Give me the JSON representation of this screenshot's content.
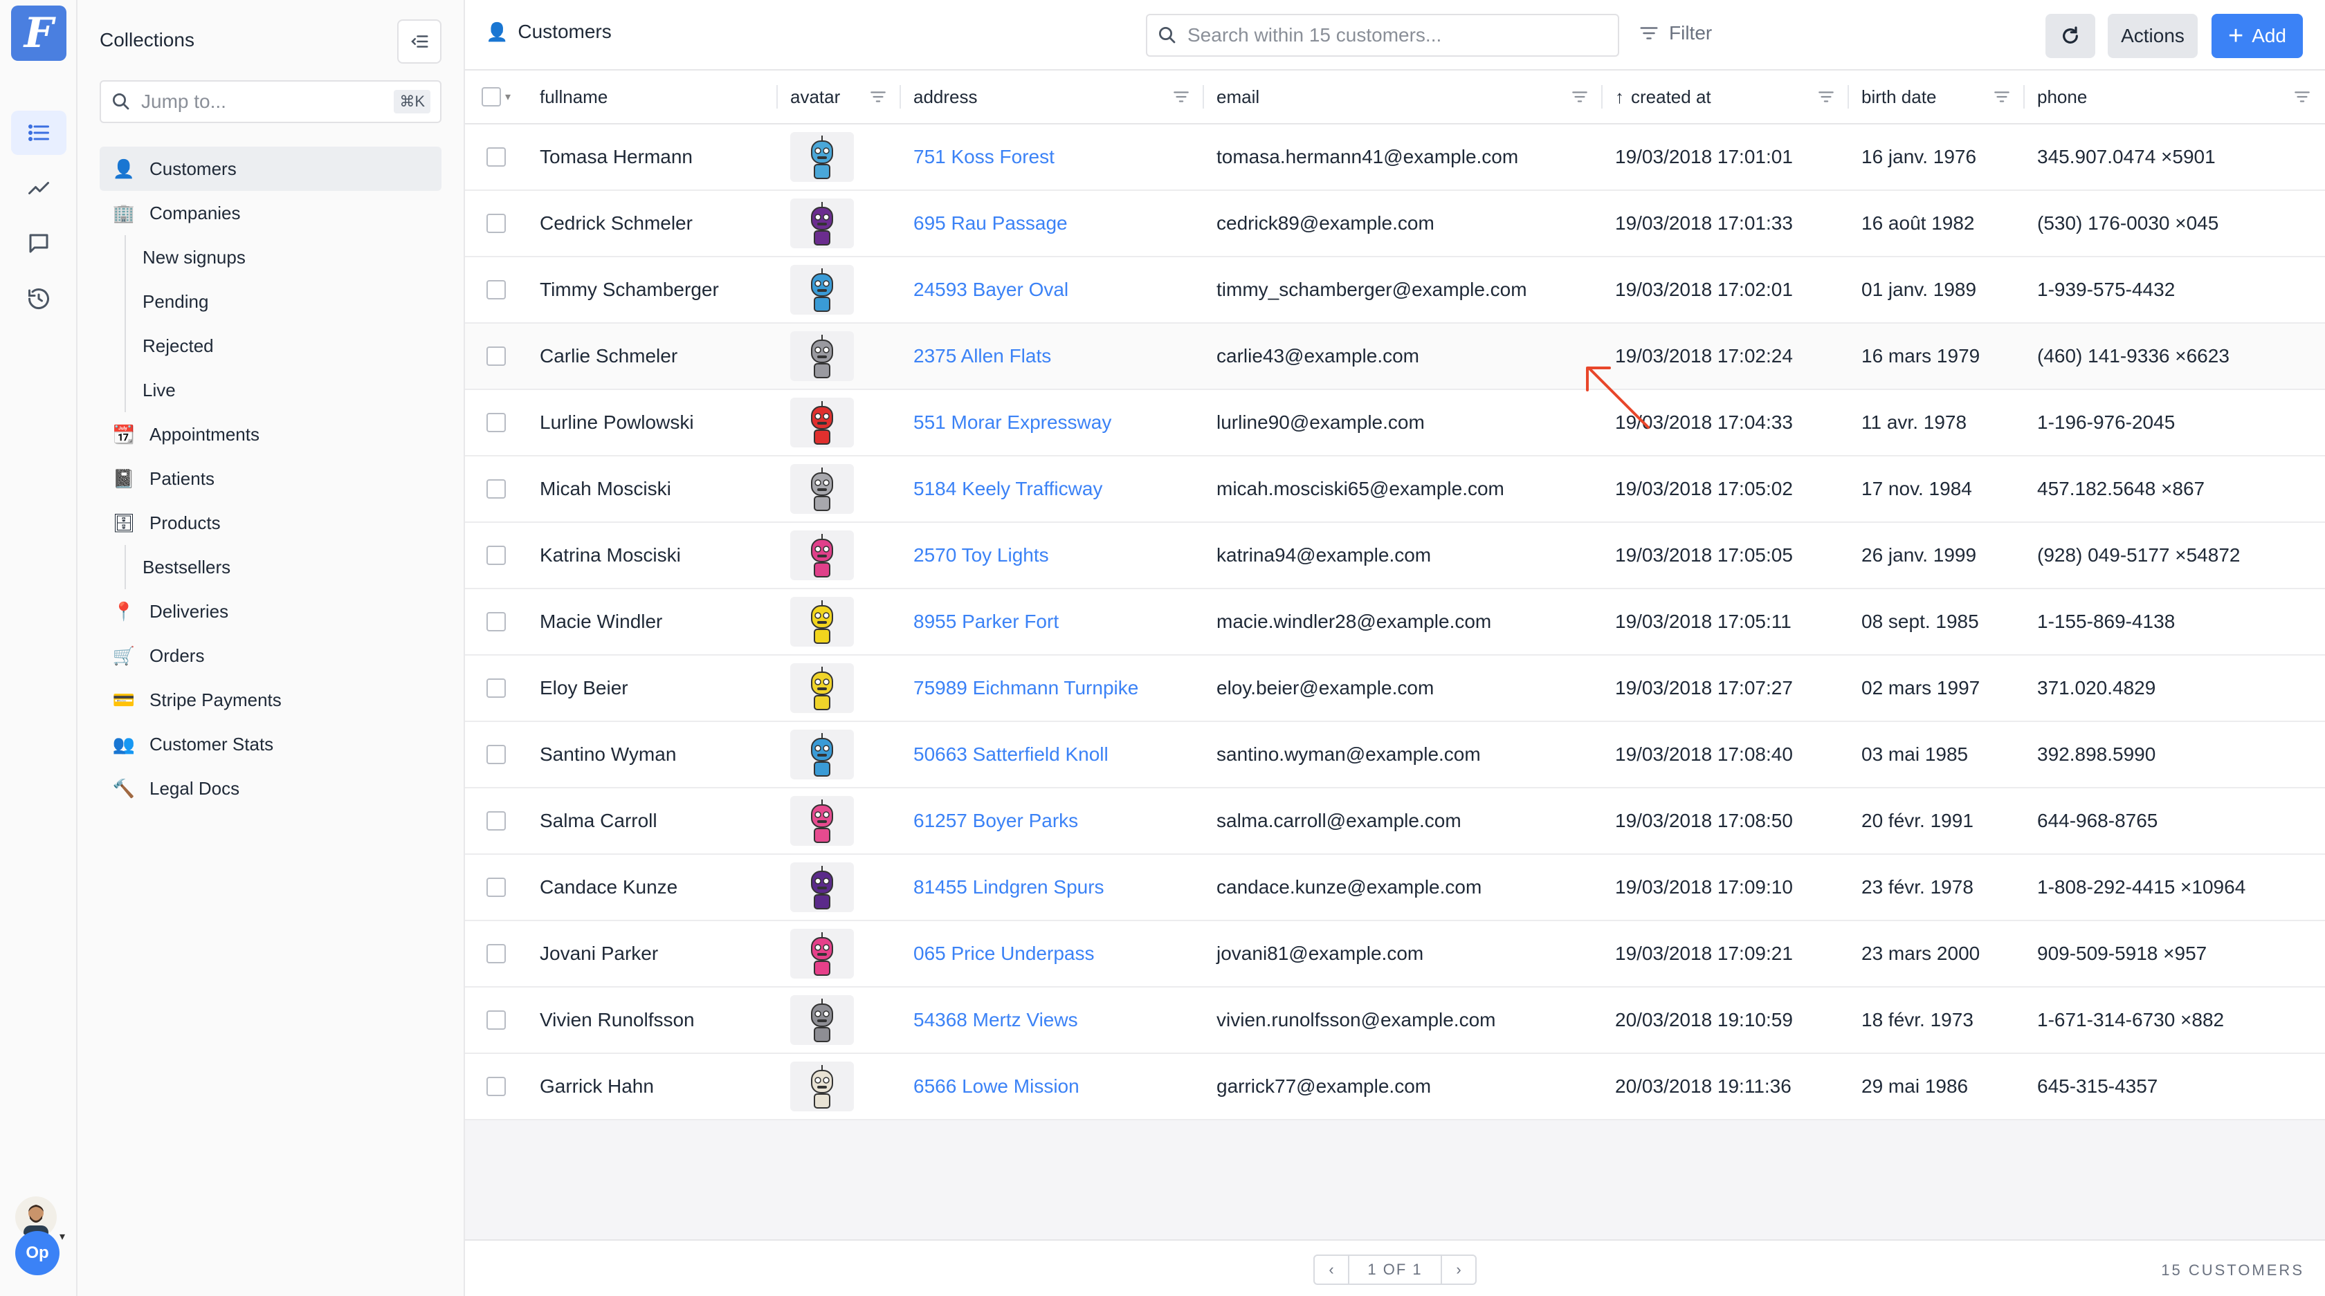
{
  "app": {
    "logo_letter": "F"
  },
  "rail": {
    "items": [
      "collections-icon",
      "analytics-icon",
      "chat-icon",
      "history-icon"
    ],
    "user_initials": "Op"
  },
  "sidebar": {
    "title": "Collections",
    "jump_placeholder": "Jump to...",
    "jump_shortcut": "⌘K",
    "items": [
      {
        "label": "Customers",
        "icon": "👤",
        "active": true,
        "sub": false
      },
      {
        "label": "Companies",
        "icon": "🏢",
        "active": false,
        "sub": false
      },
      {
        "label": "New signups",
        "sub": true
      },
      {
        "label": "Pending",
        "sub": true
      },
      {
        "label": "Rejected",
        "sub": true
      },
      {
        "label": "Live",
        "sub": true
      },
      {
        "label": "Appointments",
        "icon": "📆",
        "sub": false
      },
      {
        "label": "Patients",
        "icon": "📓",
        "sub": false
      },
      {
        "label": "Products",
        "icon": "🗄",
        "sub": false
      },
      {
        "label": "Bestsellers",
        "sub": true
      },
      {
        "label": "Deliveries",
        "icon": "📍",
        "sub": false
      },
      {
        "label": "Orders",
        "icon": "🛒",
        "sub": false
      },
      {
        "label": "Stripe Payments",
        "icon": "💳",
        "sub": false
      },
      {
        "label": "Customer Stats",
        "icon": "👥",
        "sub": false
      },
      {
        "label": "Legal Docs",
        "icon": "🔨",
        "sub": false
      }
    ]
  },
  "header": {
    "title": "Customers",
    "title_icon": "👤",
    "search_placeholder": "Search within 15 customers...",
    "filter_label": "Filter",
    "actions_label": "Actions",
    "add_label": "Add"
  },
  "table": {
    "columns": [
      "fullname",
      "avatar",
      "address",
      "email",
      "created at",
      "birth date",
      "phone"
    ],
    "sorted_column": "created at",
    "rows": [
      {
        "fullname": "Tomasa Hermann",
        "avatar_color": "#4aa7d8",
        "address": "751 Koss Forest",
        "email": "tomasa.hermann41@example.com",
        "created_at": "19/03/2018 17:01:01",
        "birth_date": "16 janv. 1976",
        "phone": "345.907.0474 ×5901"
      },
      {
        "fullname": "Cedrick Schmeler",
        "avatar_color": "#6b2d8f",
        "address": "695 Rau Passage",
        "email": "cedrick89@example.com",
        "created_at": "19/03/2018 17:01:33",
        "birth_date": "16 août 1982",
        "phone": "(530) 176-0030 ×045"
      },
      {
        "fullname": "Timmy Schamberger",
        "avatar_color": "#3a9bd6",
        "address": "24593 Bayer Oval",
        "email": "timmy_schamberger@example.com",
        "created_at": "19/03/2018 17:02:01",
        "birth_date": "01 janv. 1989",
        "phone": "1-939-575-4432"
      },
      {
        "fullname": "Carlie Schmeler",
        "avatar_color": "#9a9aa0",
        "address": "2375 Allen Flats",
        "email": "carlie43@example.com",
        "created_at": "19/03/2018 17:02:24",
        "birth_date": "16 mars 1979",
        "phone": "(460) 141-9336 ×6623"
      },
      {
        "fullname": "Lurline Powlowski",
        "avatar_color": "#e0302e",
        "address": "551 Morar Expressway",
        "email": "lurline90@example.com",
        "created_at": "19/03/2018 17:04:33",
        "birth_date": "11 avr. 1978",
        "phone": "1-196-976-2045"
      },
      {
        "fullname": "Micah Mosciski",
        "avatar_color": "#a8a8ad",
        "address": "5184 Keely Trafficway",
        "email": "micah.mosciski65@example.com",
        "created_at": "19/03/2018 17:05:02",
        "birth_date": "17 nov. 1984",
        "phone": "457.182.5648 ×867"
      },
      {
        "fullname": "Katrina Mosciski",
        "avatar_color": "#e0408a",
        "address": "2570 Toy Lights",
        "email": "katrina94@example.com",
        "created_at": "19/03/2018 17:05:05",
        "birth_date": "26 janv. 1999",
        "phone": "(928) 049-5177 ×54872"
      },
      {
        "fullname": "Macie Windler",
        "avatar_color": "#f2d51e",
        "address": "8955 Parker Fort",
        "email": "macie.windler28@example.com",
        "created_at": "19/03/2018 17:05:11",
        "birth_date": "08 sept. 1985",
        "phone": "1-155-869-4138"
      },
      {
        "fullname": "Eloy Beier",
        "avatar_color": "#f0d42a",
        "address": "75989 Eichmann Turnpike",
        "email": "eloy.beier@example.com",
        "created_at": "19/03/2018 17:07:27",
        "birth_date": "02 mars 1997",
        "phone": "371.020.4829"
      },
      {
        "fullname": "Santino Wyman",
        "avatar_color": "#3a9bd6",
        "address": "50663 Satterfield Knoll",
        "email": "santino.wyman@example.com",
        "created_at": "19/03/2018 17:08:40",
        "birth_date": "03 mai 1985",
        "phone": "392.898.5990"
      },
      {
        "fullname": "Salma Carroll",
        "avatar_color": "#e64b8f",
        "address": "61257 Boyer Parks",
        "email": "salma.carroll@example.com",
        "created_at": "19/03/2018 17:08:50",
        "birth_date": "20 févr. 1991",
        "phone": "644-968-8765"
      },
      {
        "fullname": "Candace Kunze",
        "avatar_color": "#5b2a8a",
        "address": "81455 Lindgren Spurs",
        "email": "candace.kunze@example.com",
        "created_at": "19/03/2018 17:09:10",
        "birth_date": "23 févr. 1978",
        "phone": "1-808-292-4415 ×10964"
      },
      {
        "fullname": "Jovani Parker",
        "avatar_color": "#e6408a",
        "address": "065 Price Underpass",
        "email": "jovani81@example.com",
        "created_at": "19/03/2018 17:09:21",
        "birth_date": "23 mars 2000",
        "phone": "909-509-5918 ×957"
      },
      {
        "fullname": "Vivien Runolfsson",
        "avatar_color": "#8e8e94",
        "address": "54368 Mertz Views",
        "email": "vivien.runolfsson@example.com",
        "created_at": "20/03/2018 19:10:59",
        "birth_date": "18 févr. 1973",
        "phone": "1-671-314-6730 ×882"
      },
      {
        "fullname": "Garrick Hahn",
        "avatar_color": "#e8e2d4",
        "address": "6566 Lowe Mission",
        "email": "garrick77@example.com",
        "created_at": "20/03/2018 19:11:36",
        "birth_date": "29 mai 1986",
        "phone": "645-315-4357"
      }
    ]
  },
  "footer": {
    "page_info": "1 OF 1",
    "count_label": "15 CUSTOMERS"
  },
  "colors": {
    "accent": "#3b82f6",
    "link": "#3b82f6",
    "annotation_arrow": "#e8462a"
  }
}
